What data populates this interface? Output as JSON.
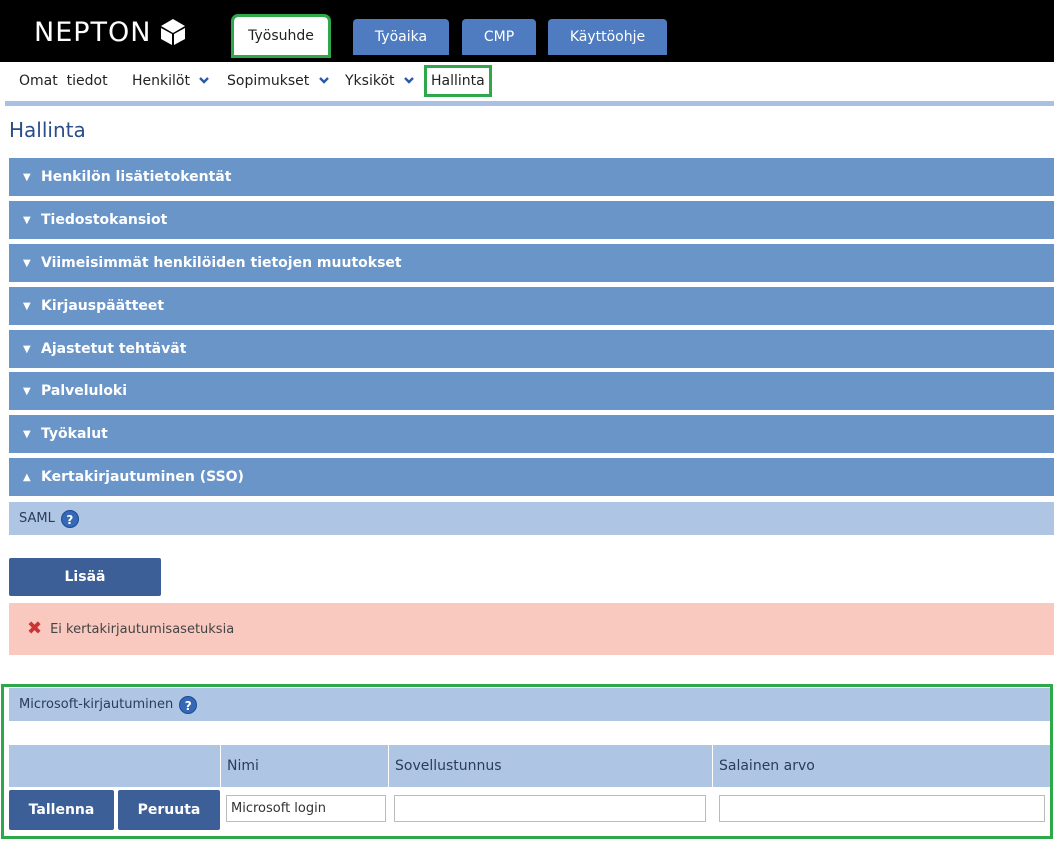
{
  "brand": {
    "name": "NEPTON"
  },
  "tabs": [
    {
      "label": "Työsuhde",
      "active": true
    },
    {
      "label": "Työaika",
      "active": false
    },
    {
      "label": "CMP",
      "active": false
    },
    {
      "label": "Käyttöohje",
      "active": false
    }
  ],
  "subnav": [
    {
      "label": "Omat  tiedot",
      "has_dropdown": false
    },
    {
      "label": "Henkilöt",
      "has_dropdown": true
    },
    {
      "label": "Sopimukset",
      "has_dropdown": true
    },
    {
      "label": "Yksiköt",
      "has_dropdown": true
    },
    {
      "label": "Hallinta",
      "has_dropdown": false,
      "current": true
    }
  ],
  "page": {
    "title": "Hallinta"
  },
  "sections": [
    {
      "label": "Henkilön lisätietokentät",
      "expanded": false
    },
    {
      "label": "Tiedostokansiot",
      "expanded": false
    },
    {
      "label": "Viimeisimmät henkilöiden tietojen muutokset",
      "expanded": false
    },
    {
      "label": "Kirjauspäätteet",
      "expanded": false
    },
    {
      "label": "Ajastetut tehtävät",
      "expanded": false
    },
    {
      "label": "Palveluloki",
      "expanded": false
    },
    {
      "label": "Työkalut",
      "expanded": false
    },
    {
      "label": "Kertakirjautuminen (SSO)",
      "expanded": true
    }
  ],
  "sso": {
    "saml": {
      "label": "SAML",
      "help_icon": "question-circle-icon"
    },
    "add_button": "Lisää",
    "error_message": "Ei kertakirjautumisasetuksia",
    "microsoft": {
      "label": "Microsoft-kirjautuminen",
      "columns": [
        "Nimi",
        "Sovellustunnus",
        "Salainen arvo"
      ],
      "save_button": "Tallenna",
      "cancel_button": "Peruuta",
      "name_value": "Microsoft login",
      "app_id_value": "",
      "secret_value": ""
    }
  },
  "colors": {
    "topbar": "#000000",
    "tab": "#4f7cc0",
    "section_header": "#6a95c9",
    "subheader": "#aec5e4",
    "primary_button": "#3d5f97",
    "error_background": "#f9c9c0",
    "highlight": "#2ea84a"
  }
}
